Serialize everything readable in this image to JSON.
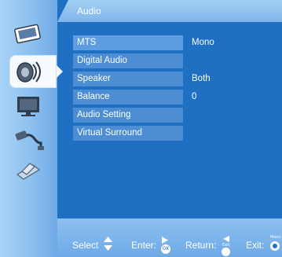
{
  "header": {
    "title": "Audio"
  },
  "sidebar": {
    "items": [
      {
        "icon": "picture-icon"
      },
      {
        "icon": "audio-icon",
        "selected": true
      },
      {
        "icon": "tv-icon"
      },
      {
        "icon": "input-source-icon"
      },
      {
        "icon": "settings-icon"
      }
    ]
  },
  "menu": {
    "items": [
      {
        "label": "MTS",
        "value": "Mono"
      },
      {
        "label": "Digital Audio",
        "value": ""
      },
      {
        "label": "Speaker",
        "value": "Both"
      },
      {
        "label": "Balance",
        "value": "0"
      },
      {
        "label": "Audio Setting",
        "value": ""
      },
      {
        "label": "Virtual Surround",
        "value": ""
      }
    ]
  },
  "footer": {
    "select_label": "Select",
    "enter_label": "Enter:",
    "return_label": "Return:",
    "exit_label": "Exit:",
    "ok_key": "OK",
    "exit_key": "Exit",
    "menu_key": "Menu"
  },
  "colors": {
    "background": "#1f6fc3",
    "menu_item": "#4c8dd3",
    "panel": "#8cc0ef"
  }
}
